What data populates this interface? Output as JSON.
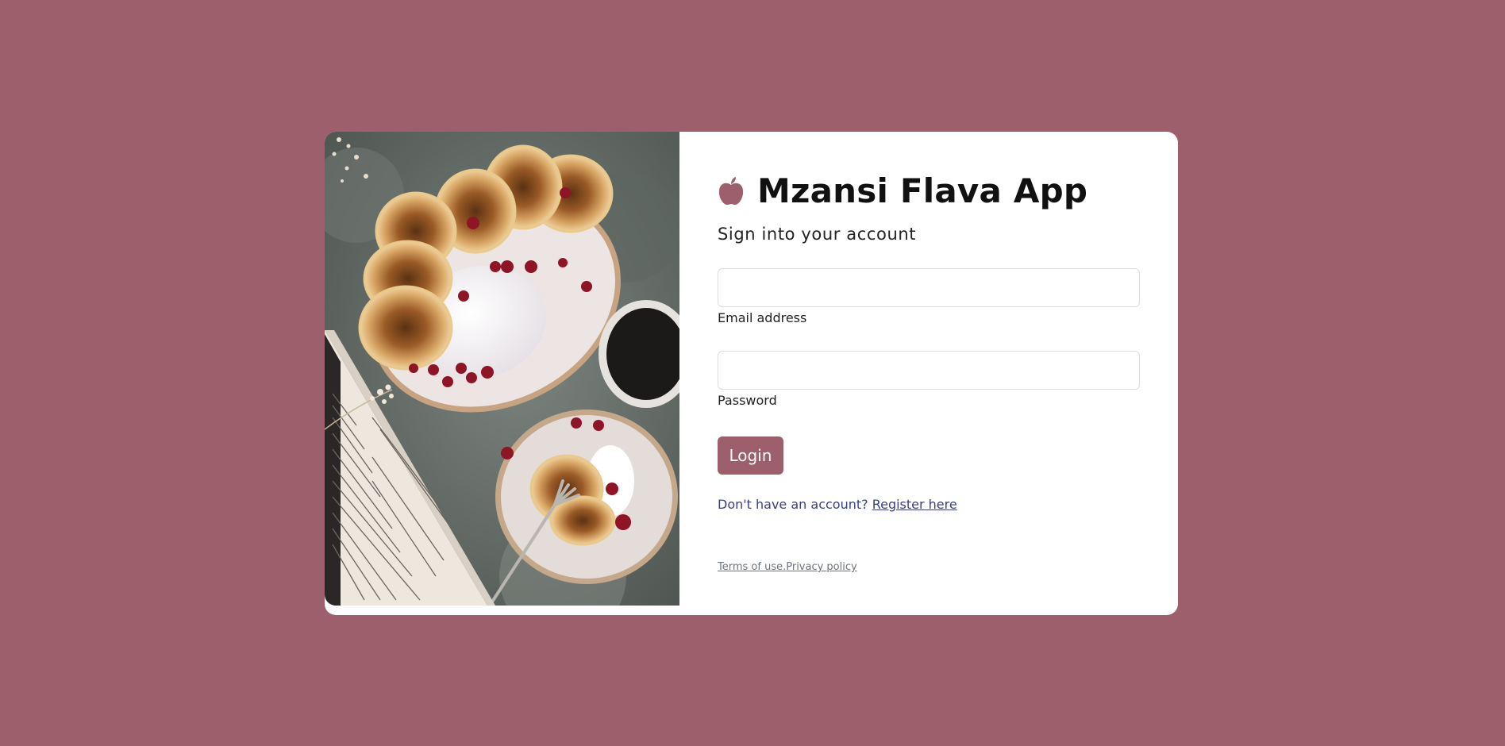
{
  "brand": {
    "icon": "apple-icon",
    "title": "Mzansi Flava App"
  },
  "subtitle": "Sign into your account",
  "form": {
    "email": {
      "value": "",
      "placeholder": "",
      "label": "Email address"
    },
    "password": {
      "value": "",
      "placeholder": "",
      "label": "Password"
    },
    "login_label": "Login"
  },
  "register": {
    "prompt": "Don't have an account? ",
    "link_label": "Register here"
  },
  "footer": {
    "terms_label": "Terms of use.",
    "privacy_label": "Privacy policy"
  },
  "colors": {
    "background": "#9c5f6b",
    "accent": "#9c5f6b",
    "link": "#393f81",
    "muted_link": "#6c757d",
    "card": "#ffffff"
  },
  "image": {
    "description_icon": "food-photo"
  }
}
